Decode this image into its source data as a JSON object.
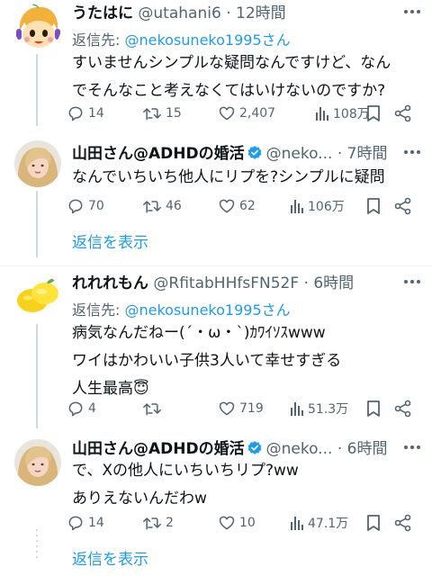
{
  "colors": {
    "accent": "#1d9bf0",
    "muted": "#536471",
    "text": "#0f1419",
    "verified": "#1d9bf0"
  },
  "tweets": [
    {
      "name": "うたはに",
      "handle": "@utahani6",
      "time": "12時間",
      "reply_prefix": "返信先: ",
      "reply_to": "@nekosuneko1995さん",
      "text": "すいませんシンプルな疑問なんですけど、なん\nでそんなこと考えなくてはいけないのですか?",
      "replies": "14",
      "retweets": "15",
      "likes": "2,407",
      "views": "108万"
    },
    {
      "name": "山田さん@ADHDの婚活",
      "handle": "@neko...",
      "time": "7時間",
      "verified": true,
      "text": "なんでいちいち他人にリプを?シンプルに疑問",
      "replies": "70",
      "retweets": "46",
      "likes": "62",
      "views": "106万"
    },
    {
      "name": "れれれもん",
      "handle": "@RfitabHHfsFN52F",
      "time": "6時間",
      "reply_prefix": "返信先: ",
      "reply_to": "@nekosuneko1995さん",
      "text_lines": [
        "病気なんだねー(´・ω・`)ｶﾜｲｿｽwww",
        "ワイはかわいい子供3人いて幸せすぎる",
        "人生最高"
      ],
      "emoji": "😇",
      "replies": "4",
      "retweets": "",
      "likes": "719",
      "views": "51.3万"
    },
    {
      "name": "山田さん@ADHDの婚活",
      "handle": "@neko...",
      "time": "6時間",
      "verified": true,
      "text": "で、Xの他人にいちいちリプ?ww\nありえないんだわw",
      "replies": "14",
      "retweets": "2",
      "likes": "10",
      "views": "47.1万"
    }
  ],
  "show_replies": "返信を表示",
  "separator": "·",
  "icons": [
    "more-icon",
    "reply-icon",
    "retweet-icon",
    "like-icon",
    "views-icon",
    "bookmark-icon",
    "share-icon",
    "verified-badge-icon"
  ]
}
